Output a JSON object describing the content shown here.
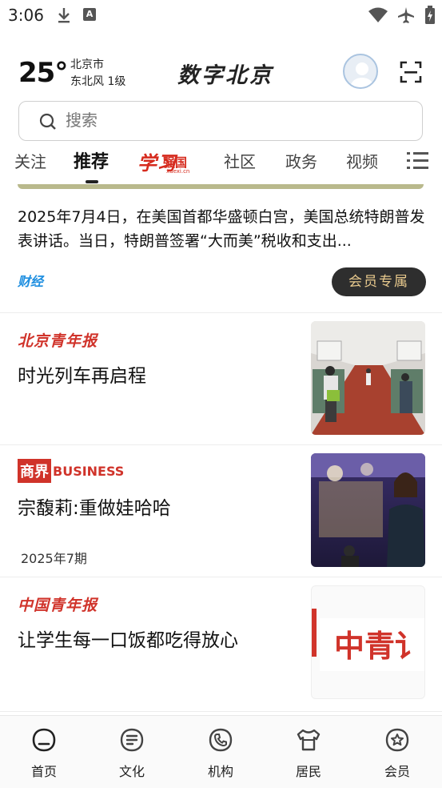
{
  "status_bar": {
    "time": "3:06",
    "icons": [
      "download-icon",
      "a-notification-icon",
      "wifi-icon",
      "airplane-icon",
      "battery-icon"
    ]
  },
  "header": {
    "temperature": "25°",
    "city": "北京市",
    "wind": "东北风  1级",
    "brand": "数字北京"
  },
  "search": {
    "placeholder": "搜索"
  },
  "tabs": [
    {
      "label": "关注"
    },
    {
      "label": "推荐",
      "active": true
    },
    {
      "label": "学习强国",
      "logo_text": "学习",
      "logo_sub": "强国",
      "logo_url": "xuexi.cn"
    },
    {
      "label": "社区"
    },
    {
      "label": "政务"
    },
    {
      "label": "视频"
    }
  ],
  "feed": {
    "lead": {
      "text": "2025年7月4日，在美国首都华盛顿白宫，美国总统特朗普发表讲话。当日，特朗普签署“大而美”税收和支出...",
      "source": "财经",
      "badge": "会员专属"
    },
    "items": [
      {
        "source": "北京青年报",
        "headline": "时光列车再启程",
        "date": ""
      },
      {
        "source_logo_box": "商界",
        "source_logo_text": "BUSINESS",
        "headline": "宗馥莉:重做娃哈哈",
        "date": "2025年7期"
      },
      {
        "source": "中国青年报",
        "headline": "让学生每一口饭都吃得放心",
        "date": "",
        "thumb_text": "中青讠"
      }
    ]
  },
  "bottom_nav": [
    {
      "label": "首页",
      "icon": "home-face-icon"
    },
    {
      "label": "文化",
      "icon": "document-lines-icon"
    },
    {
      "label": "机构",
      "icon": "phone-handset-icon"
    },
    {
      "label": "居民",
      "icon": "residents-shirt-icon"
    },
    {
      "label": "会员",
      "icon": "vip-star-icon"
    }
  ],
  "colors": {
    "accent_red": "#d0332a",
    "badge_dark": "#2e2e2e",
    "badge_gold": "#e8c98d",
    "caijing_blue": "#1f8fe0"
  }
}
